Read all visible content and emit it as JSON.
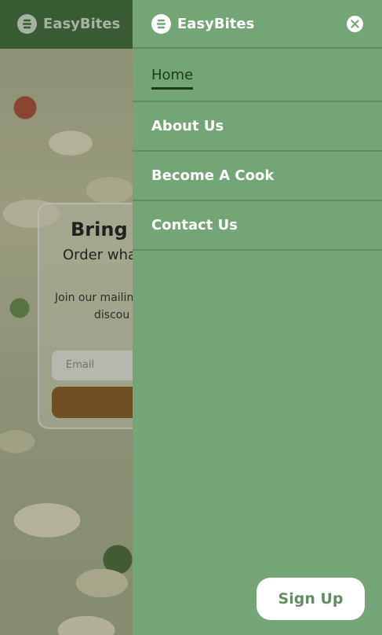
{
  "brand": {
    "name": "EasyBites",
    "logo_icon": "easybites-logo-icon"
  },
  "background_page": {
    "hero_title": "Bring y",
    "hero_subtitle": "Order wha",
    "body_line1": "Join our mailin",
    "body_line2": "discou",
    "email_placeholder": "Email"
  },
  "drawer": {
    "close_icon": "close-icon",
    "nav_items": [
      {
        "label": "Home",
        "active": true
      },
      {
        "label": "About Us",
        "active": false
      },
      {
        "label": "Become A Cook",
        "active": false
      },
      {
        "label": "Contact Us",
        "active": false
      }
    ],
    "signup_label": "Sign Up"
  },
  "colors": {
    "drawer_bg": "#74a576",
    "header_bg": "#3f6a3b",
    "active_text": "#1d3a1d",
    "signup_text": "#5f8f61",
    "submit_button": "#8a5a22"
  }
}
